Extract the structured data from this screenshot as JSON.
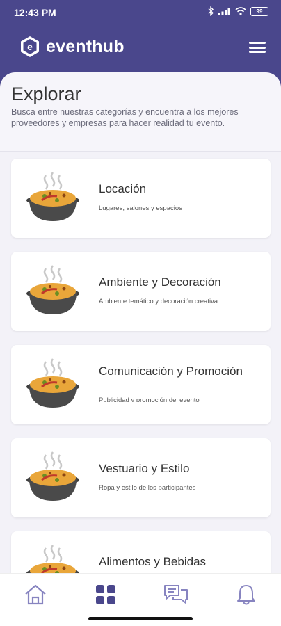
{
  "status_bar": {
    "time": "12:43 PM",
    "battery": "99"
  },
  "header": {
    "brand": "eventhub",
    "logo_letter": "e"
  },
  "intro": {
    "title": "Explorar",
    "subtitle": "Busca entre nuestras categorías y encuentra a los mejores proveedores y empresas para hacer realidad tu evento."
  },
  "categories": [
    {
      "title": "Locación",
      "description": "Lugares, salones y espacios"
    },
    {
      "title": "Ambiente y Decoración",
      "description": "Ambiente temático y decoración creativa"
    },
    {
      "title": "Comunicación y Promoción",
      "description": "Publicidad y promoción del evento"
    },
    {
      "title": "Vestuario y Estilo",
      "description": "Ropa y estilo de los participantes"
    },
    {
      "title": "Alimentos y Bebidas",
      "description": ""
    }
  ],
  "bottom_nav": {
    "items": [
      "home",
      "categories",
      "messages",
      "notifications"
    ],
    "active": "categories"
  },
  "colors": {
    "primary": "#4a478c",
    "nav_inactive": "#8784c0",
    "background": "#f3f2f8"
  }
}
